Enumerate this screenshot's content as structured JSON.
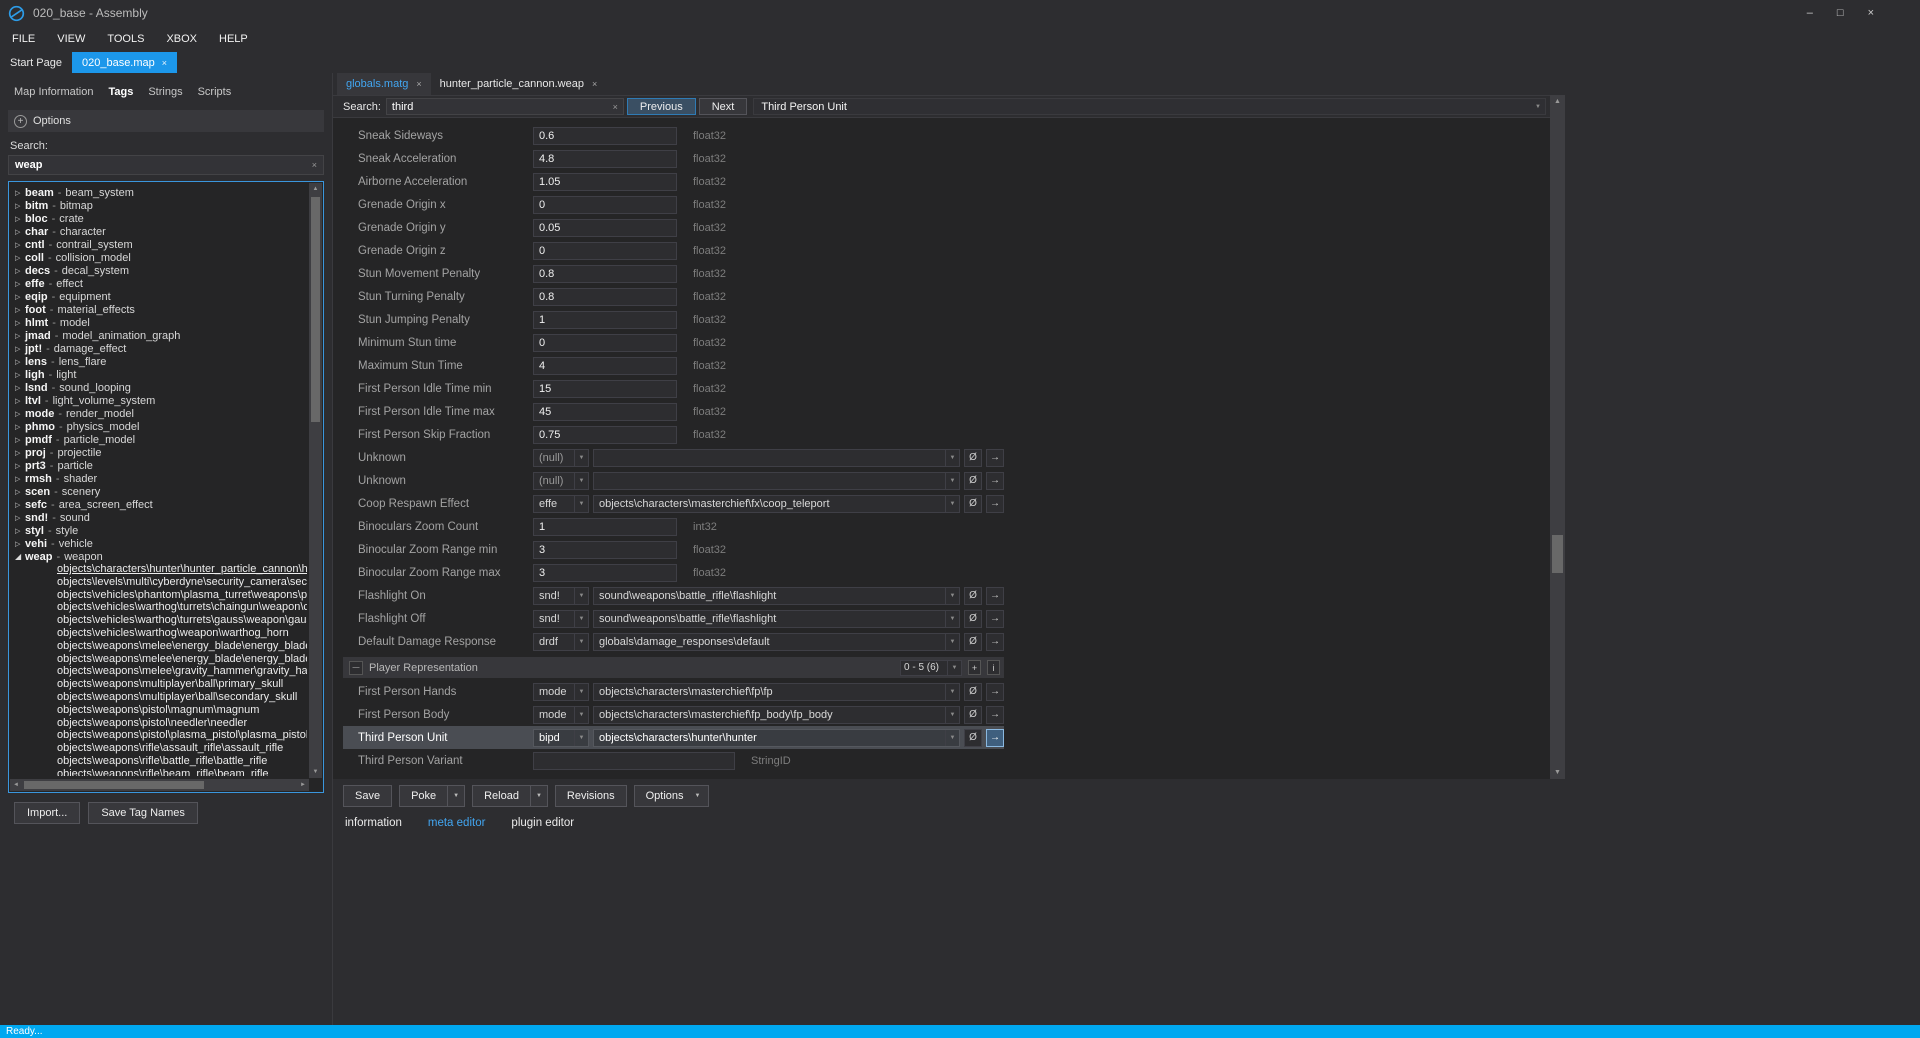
{
  "icons": {
    "minimize": "–",
    "maximize": "□",
    "close": "×",
    "close_tab": "×",
    "clear": "×",
    "dropdown": "▼",
    "tree_collapsed": "▷",
    "tree_expanded": "◢",
    "plus": "+",
    "collapse": "—",
    "add": "+",
    "info": "i",
    "null_ref": "Ø",
    "goto": "→",
    "scroll_up": "▲",
    "scroll_down": "▼",
    "scroll_left": "◄",
    "scroll_right": "►"
  },
  "window": {
    "title": "020_base - Assembly",
    "status": "Ready..."
  },
  "menu": [
    "FILE",
    "VIEW",
    "TOOLS",
    "XBOX",
    "HELP"
  ],
  "map_tabs": [
    {
      "label": "Start Page",
      "active": false,
      "closable": false
    },
    {
      "label": "020_base.map",
      "active": true,
      "closable": true
    }
  ],
  "sidebar": {
    "tabs": [
      {
        "label": "Map Information",
        "active": false
      },
      {
        "label": "Tags",
        "active": true
      },
      {
        "label": "Strings",
        "active": false
      },
      {
        "label": "Scripts",
        "active": false
      }
    ],
    "options_label": "Options",
    "search_label": "Search:",
    "search_value": "weap",
    "import_button": "Import...",
    "save_tag_names_button": "Save Tag Names",
    "tag_classes": [
      {
        "code": "beam",
        "name": "beam_system"
      },
      {
        "code": "bitm",
        "name": "bitmap"
      },
      {
        "code": "bloc",
        "name": "crate"
      },
      {
        "code": "char",
        "name": "character"
      },
      {
        "code": "cntl",
        "name": "contrail_system"
      },
      {
        "code": "coll",
        "name": "collision_model"
      },
      {
        "code": "decs",
        "name": "decal_system"
      },
      {
        "code": "effe",
        "name": "effect"
      },
      {
        "code": "eqip",
        "name": "equipment"
      },
      {
        "code": "foot",
        "name": "material_effects"
      },
      {
        "code": "hlmt",
        "name": "model"
      },
      {
        "code": "jmad",
        "name": "model_animation_graph"
      },
      {
        "code": "jpt!",
        "name": "damage_effect"
      },
      {
        "code": "lens",
        "name": "lens_flare"
      },
      {
        "code": "ligh",
        "name": "light"
      },
      {
        "code": "lsnd",
        "name": "sound_looping"
      },
      {
        "code": "ltvl",
        "name": "light_volume_system"
      },
      {
        "code": "mode",
        "name": "render_model"
      },
      {
        "code": "phmo",
        "name": "physics_model"
      },
      {
        "code": "pmdf",
        "name": "particle_model"
      },
      {
        "code": "proj",
        "name": "projectile"
      },
      {
        "code": "prt3",
        "name": "particle"
      },
      {
        "code": "rmsh",
        "name": "shader"
      },
      {
        "code": "scen",
        "name": "scenery"
      },
      {
        "code": "sefc",
        "name": "area_screen_effect"
      },
      {
        "code": "snd!",
        "name": "sound"
      },
      {
        "code": "styl",
        "name": "style"
      },
      {
        "code": "vehi",
        "name": "vehicle"
      },
      {
        "code": "weap",
        "name": "weapon",
        "expanded": true,
        "children": [
          {
            "path": "objects\\characters\\hunter\\hunter_particle_cannon\\hunter",
            "active": true
          },
          {
            "path": "objects\\levels\\multi\\cyberdyne\\security_camera\\security_"
          },
          {
            "path": "objects\\vehicles\\phantom\\plasma_turret\\weapons\\phant"
          },
          {
            "path": "objects\\vehicles\\warthog\\turrets\\chaingun\\weapon\\chair"
          },
          {
            "path": "objects\\vehicles\\warthog\\turrets\\gauss\\weapon\\gauss_tu"
          },
          {
            "path": "objects\\vehicles\\warthog\\weapon\\warthog_horn"
          },
          {
            "path": "objects\\weapons\\melee\\energy_blade\\energy_blade"
          },
          {
            "path": "objects\\weapons\\melee\\energy_blade\\energy_blade_use"
          },
          {
            "path": "objects\\weapons\\melee\\gravity_hammer\\gravity_hamme"
          },
          {
            "path": "objects\\weapons\\multiplayer\\ball\\primary_skull"
          },
          {
            "path": "objects\\weapons\\multiplayer\\ball\\secondary_skull"
          },
          {
            "path": "objects\\weapons\\pistol\\magnum\\magnum"
          },
          {
            "path": "objects\\weapons\\pistol\\needler\\needler"
          },
          {
            "path": "objects\\weapons\\pistol\\plasma_pistol\\plasma_pistol"
          },
          {
            "path": "objects\\weapons\\rifle\\assault_rifle\\assault_rifle"
          },
          {
            "path": "objects\\weapons\\rifle\\battle_rifle\\battle_rifle"
          },
          {
            "path": "objects\\weapons\\rifle\\beam_rifle\\beam_rifle"
          }
        ]
      }
    ]
  },
  "editor": {
    "tabs": [
      {
        "label": "globals.matg",
        "active": true
      },
      {
        "label": "hunter_particle_cannon.weap",
        "active": false
      }
    ],
    "search": {
      "label": "Search:",
      "value": "third",
      "previous_button": "Previous",
      "next_button": "Next",
      "result": "Third Person Unit"
    },
    "fields": [
      {
        "kind": "value",
        "label": "Sneak Sideways",
        "value": "0.6",
        "type": "float32"
      },
      {
        "kind": "value",
        "label": "Sneak Acceleration",
        "value": "4.8",
        "type": "float32"
      },
      {
        "kind": "value",
        "label": "Airborne Acceleration",
        "value": "1.05",
        "type": "float32"
      },
      {
        "kind": "value",
        "label": "Grenade Origin x",
        "value": "0",
        "type": "float32"
      },
      {
        "kind": "value",
        "label": "Grenade Origin y",
        "value": "0.05",
        "type": "float32"
      },
      {
        "kind": "value",
        "label": "Grenade Origin z",
        "value": "0",
        "type": "float32"
      },
      {
        "kind": "value",
        "label": "Stun Movement Penalty",
        "value": "0.8",
        "type": "float32"
      },
      {
        "kind": "value",
        "label": "Stun Turning Penalty",
        "value": "0.8",
        "type": "float32"
      },
      {
        "kind": "value",
        "label": "Stun Jumping Penalty",
        "value": "1",
        "type": "float32"
      },
      {
        "kind": "value",
        "label": "Minimum Stun time",
        "value": "0",
        "type": "float32"
      },
      {
        "kind": "value",
        "label": "Maximum Stun Time",
        "value": "4",
        "type": "float32"
      },
      {
        "kind": "value",
        "label": "First Person Idle Time min",
        "value": "15",
        "type": "float32"
      },
      {
        "kind": "value",
        "label": "First Person Idle Time max",
        "value": "45",
        "type": "float32"
      },
      {
        "kind": "value",
        "label": "First Person Skip Fraction",
        "value": "0.75",
        "type": "float32"
      },
      {
        "kind": "tagref",
        "label": "Unknown",
        "class": "(null)",
        "path": ""
      },
      {
        "kind": "tagref",
        "label": "Unknown",
        "class": "(null)",
        "path": ""
      },
      {
        "kind": "tagref",
        "label": "Coop Respawn Effect",
        "class": "effe",
        "path": "objects\\characters\\masterchief\\fx\\coop_teleport"
      },
      {
        "kind": "value",
        "label": "Binoculars Zoom Count",
        "value": "1",
        "type": "int32"
      },
      {
        "kind": "value",
        "label": "Binocular Zoom Range min",
        "value": "3",
        "type": "float32"
      },
      {
        "kind": "value",
        "label": "Binocular Zoom Range max",
        "value": "3",
        "type": "float32"
      },
      {
        "kind": "tagref",
        "label": "Flashlight On",
        "class": "snd!",
        "path": "sound\\weapons\\battle_rifle\\flashlight"
      },
      {
        "kind": "tagref",
        "label": "Flashlight Off",
        "class": "snd!",
        "path": "sound\\weapons\\battle_rifle\\flashlight"
      },
      {
        "kind": "tagref",
        "label": "Default Damage Response",
        "class": "drdf",
        "path": "globals\\damage_responses\\default"
      }
    ],
    "section": {
      "title": "Player Representation",
      "range": "0 - 5 (6)",
      "fields": [
        {
          "kind": "tagref",
          "label": "First Person Hands",
          "class": "mode",
          "path": "objects\\characters\\masterchief\\fp\\fp"
        },
        {
          "kind": "tagref",
          "label": "First Person Body",
          "class": "mode",
          "path": "objects\\characters\\masterchief\\fp_body\\fp_body"
        },
        {
          "kind": "tagref",
          "label": "Third Person Unit",
          "class": "bipd",
          "path": "objects\\characters\\hunter\\hunter",
          "highlighted": true
        },
        {
          "kind": "stringid",
          "label": "Third Person Variant",
          "value": "",
          "type": "StringID"
        }
      ]
    },
    "actions": [
      {
        "label": "Save"
      },
      {
        "label": "Poke",
        "split": true
      },
      {
        "label": "Reload",
        "split": true
      },
      {
        "label": "Revisions"
      },
      {
        "label": "Options",
        "arrow": true
      }
    ],
    "bottom_tabs": [
      {
        "label": "information",
        "active": false
      },
      {
        "label": "meta editor",
        "active": true
      },
      {
        "label": "plugin editor",
        "active": false
      }
    ]
  }
}
